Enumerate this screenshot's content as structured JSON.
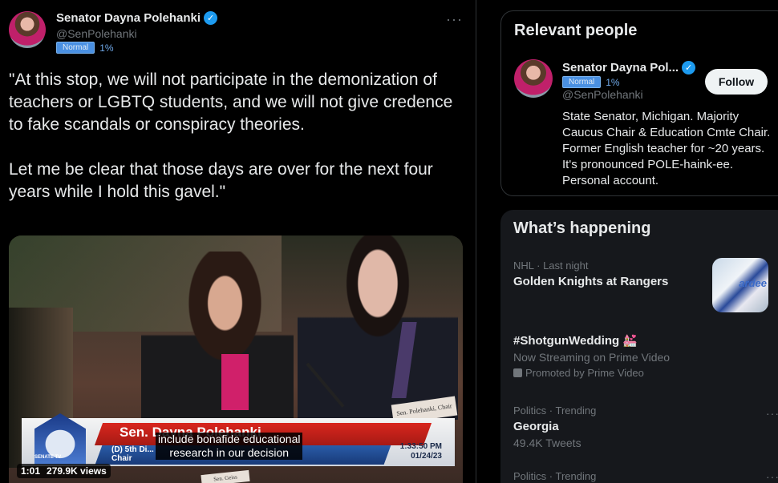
{
  "tweet": {
    "display_name": "Senator Dayna Polehanki",
    "handle": "@SenPolehanki",
    "badge": "Normal",
    "percent": "1%",
    "more": "···",
    "text": "\"At this stop, we will not participate in the demonization of teachers or LGBTQ students, and we will not give credence to fake scandals or conspiracy theories.\n\nLet me be clear that those days are over for the next four years while I hold this gavel.\"",
    "video": {
      "chyron_name": "Sen. Dayna Polehanki",
      "chyron_sub": "(D) 5th Di...\nChair",
      "channel": "SENATE TV",
      "clock": "1:33:50 PM\n01/24/23",
      "name_sign": "Sen. Polehanki, Chair",
      "name_sign2": "Sen. Geiss",
      "caption": "include bonafide educational\nresearch in our decision",
      "duration": "1:01",
      "views": "279.9K views"
    }
  },
  "relevant_people": {
    "title": "Relevant people",
    "name": "Senator Dayna Pol...",
    "badge": "Normal",
    "percent": "1%",
    "handle": "@SenPolehanki",
    "follow_label": "Follow",
    "bio": "State Senator, Michigan. Majority Caucus Chair & Education Cmte Chair. Former English teacher for ~20 years. It's pronounced POLE-haink-ee. Personal account."
  },
  "whats_happening": {
    "title": "What’s happening",
    "trends": [
      {
        "meta": "NHL · Last night",
        "name": "Golden Knights at Rangers",
        "thumb_text": "ardee"
      },
      {
        "name": "#ShotgunWedding 💒",
        "sub": "Now Streaming on Prime Video",
        "promo": "Promoted by Prime Video"
      },
      {
        "meta": "Politics · Trending",
        "name": "Georgia",
        "sub": "49.4K Tweets",
        "dots": "···"
      },
      {
        "meta": "Politics · Trending",
        "dots": "···"
      }
    ]
  }
}
